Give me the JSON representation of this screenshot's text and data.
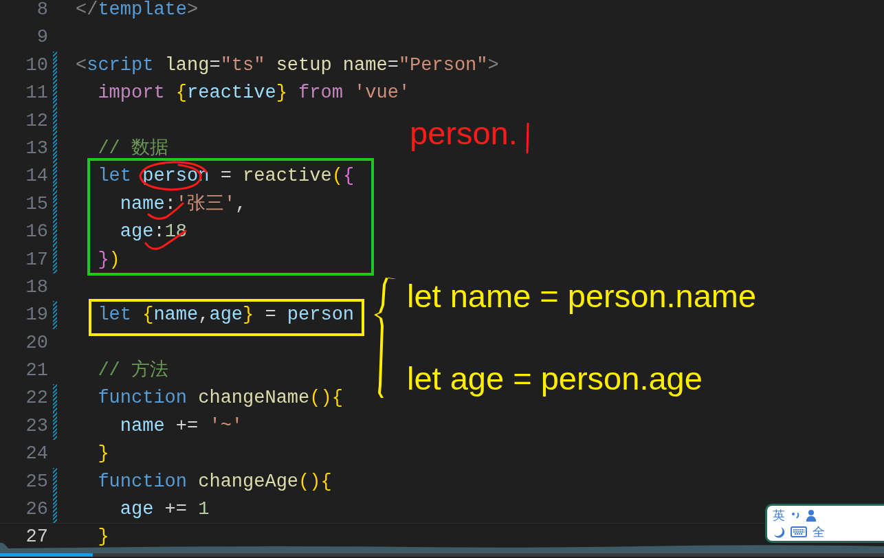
{
  "editor": {
    "lines": [
      {
        "number": "8",
        "changed": false,
        "current": false,
        "tokens": [
          {
            "text": "</",
            "kind": "punct"
          },
          {
            "text": "template",
            "kind": "tag"
          },
          {
            "text": ">",
            "kind": "punct"
          }
        ]
      },
      {
        "number": "9",
        "changed": false,
        "current": false
      },
      {
        "number": "10",
        "changed": true,
        "current": false,
        "tokens": [
          {
            "text": "<",
            "kind": "punct"
          },
          {
            "text": "script ",
            "kind": "tag"
          },
          {
            "text": "lang",
            "kind": "attr"
          },
          {
            "text": "=",
            "kind": "op"
          },
          {
            "text": "\"ts\" ",
            "kind": "str"
          },
          {
            "text": "setup name",
            "kind": "attr"
          },
          {
            "text": "=",
            "kind": "op"
          },
          {
            "text": "\"Person\"",
            "kind": "str"
          },
          {
            "text": ">",
            "kind": "punct"
          }
        ]
      },
      {
        "number": "11",
        "changed": true,
        "current": false,
        "tokens": [
          {
            "text": "  import ",
            "kind": "kw2"
          },
          {
            "text": "{",
            "kind": "brace"
          },
          {
            "text": "reactive",
            "kind": "var"
          },
          {
            "text": "} ",
            "kind": "brace"
          },
          {
            "text": "from ",
            "kind": "kw2"
          },
          {
            "text": "'vue'",
            "kind": "str"
          }
        ]
      },
      {
        "number": "12",
        "changed": true,
        "current": false
      },
      {
        "number": "13",
        "changed": true,
        "current": false,
        "tokens": [
          {
            "text": "  // 数据",
            "kind": "comment"
          }
        ]
      },
      {
        "number": "14",
        "changed": true,
        "current": false,
        "tokens": [
          {
            "text": "  let ",
            "kind": "kw"
          },
          {
            "text": "person",
            "kind": "var"
          },
          {
            "text": " = ",
            "kind": "op"
          },
          {
            "text": "reactive",
            "kind": "fn"
          },
          {
            "text": "(",
            "kind": "brace"
          },
          {
            "text": "{",
            "kind": "brace2"
          }
        ]
      },
      {
        "number": "15",
        "changed": true,
        "current": false,
        "tokens": [
          {
            "text": "    name",
            "kind": "var"
          },
          {
            "text": ":",
            "kind": "op"
          },
          {
            "text": "'张三'",
            "kind": "str"
          },
          {
            "text": ",",
            "kind": "op"
          }
        ]
      },
      {
        "number": "16",
        "changed": true,
        "current": false,
        "tokens": [
          {
            "text": "    age",
            "kind": "var"
          },
          {
            "text": ":",
            "kind": "op"
          },
          {
            "text": "18",
            "kind": "num"
          }
        ]
      },
      {
        "number": "17",
        "changed": true,
        "current": false,
        "tokens": [
          {
            "text": "  }",
            "kind": "brace2"
          },
          {
            "text": ")",
            "kind": "brace"
          }
        ]
      },
      {
        "number": "18",
        "changed": false,
        "current": false
      },
      {
        "number": "19",
        "changed": true,
        "current": false,
        "tokens": [
          {
            "text": "  let ",
            "kind": "kw"
          },
          {
            "text": "{",
            "kind": "brace"
          },
          {
            "text": "name",
            "kind": "var"
          },
          {
            "text": ",",
            "kind": "op"
          },
          {
            "text": "age",
            "kind": "var"
          },
          {
            "text": "}",
            "kind": "brace"
          },
          {
            "text": " = ",
            "kind": "op"
          },
          {
            "text": "person",
            "kind": "var"
          }
        ]
      },
      {
        "number": "20",
        "changed": false,
        "current": false
      },
      {
        "number": "21",
        "changed": false,
        "current": false,
        "tokens": [
          {
            "text": "  // 方法",
            "kind": "comment"
          }
        ]
      },
      {
        "number": "22",
        "changed": true,
        "current": false,
        "tokens": [
          {
            "text": "  function ",
            "kind": "kw"
          },
          {
            "text": "changeName",
            "kind": "fn"
          },
          {
            "text": "(){",
            "kind": "brace"
          }
        ]
      },
      {
        "number": "23",
        "changed": true,
        "current": false,
        "tokens": [
          {
            "text": "    name",
            "kind": "var"
          },
          {
            "text": " += ",
            "kind": "op"
          },
          {
            "text": "'~'",
            "kind": "str"
          }
        ]
      },
      {
        "number": "24",
        "changed": false,
        "current": false,
        "tokens": [
          {
            "text": "  }",
            "kind": "brace"
          }
        ]
      },
      {
        "number": "25",
        "changed": true,
        "current": false,
        "tokens": [
          {
            "text": "  function ",
            "kind": "kw"
          },
          {
            "text": "changeAge",
            "kind": "fn"
          },
          {
            "text": "(){",
            "kind": "brace"
          }
        ]
      },
      {
        "number": "26",
        "changed": true,
        "current": false,
        "tokens": [
          {
            "text": "    age",
            "kind": "var"
          },
          {
            "text": " += ",
            "kind": "op"
          },
          {
            "text": "1",
            "kind": "num"
          }
        ]
      },
      {
        "number": "27",
        "changed": false,
        "current": true,
        "tokens": [
          {
            "text": "  }",
            "kind": "brace"
          }
        ]
      }
    ]
  },
  "annotations": [
    {
      "kind": "circle",
      "color": "#ff1a1a"
    },
    {
      "kind": "tick",
      "color": "#ff1a1a"
    },
    {
      "kind": "tick",
      "color": "#ff1a1a"
    },
    {
      "kind": "box",
      "color": "#1ec81e"
    },
    {
      "kind": "text",
      "color": "#ff1a1a",
      "text": "person."
    },
    {
      "kind": "cursor",
      "color": "#ff1a1a"
    },
    {
      "kind": "box",
      "color": "#ffee00"
    },
    {
      "kind": "brace",
      "color": "#ffee00"
    },
    {
      "kind": "text",
      "color": "#ffee00",
      "text": "let name = person.name"
    },
    {
      "kind": "text",
      "color": "#ffee00",
      "text": "let age = person.age"
    }
  ],
  "ime_toolbar": {
    "language": "英",
    "width": "全"
  },
  "player": {
    "level": 0.105
  }
}
